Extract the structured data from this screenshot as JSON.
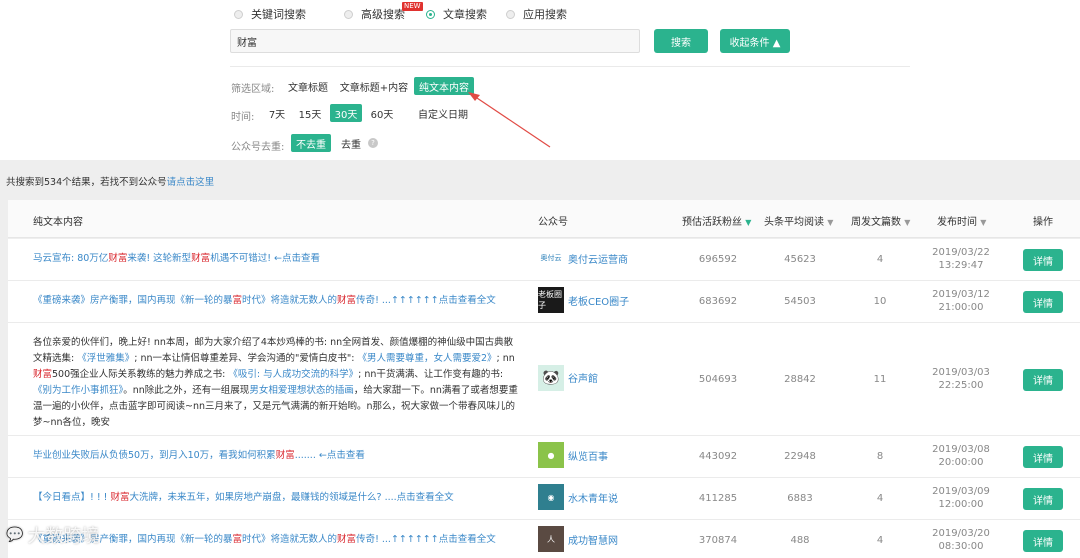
{
  "search_modes": [
    {
      "label": "关键词搜索",
      "selected": false
    },
    {
      "label": "高级搜索",
      "selected": false,
      "badge": "NEW"
    },
    {
      "label": "文章搜索",
      "selected": true
    },
    {
      "label": "应用搜索",
      "selected": false
    }
  ],
  "search": {
    "value": "财富",
    "search_button": "搜索",
    "collapse_button": "收起条件 ▲"
  },
  "filters": {
    "area_label": "筛选区域:",
    "area_options": [
      "文章标题",
      "文章标题+内容",
      "纯文本内容"
    ],
    "area_selected": 2,
    "time_label": "时间:",
    "time_options": [
      "7天",
      "15天",
      "30天",
      "60天",
      "自定义日期"
    ],
    "time_selected": 2,
    "dedupe_label": "公众号去重:",
    "dedupe_options": [
      "不去重",
      "去重"
    ],
    "dedupe_selected": 0,
    "help_icon": "help-circle-icon"
  },
  "result_summary": {
    "text": "共搜索到534个结果，若找不到公众号",
    "link": "请点击这里"
  },
  "table": {
    "headers": [
      "纯文本内容",
      "公众号",
      "预估活跃粉丝",
      "头条平均阅读",
      "周发文篇数",
      "发布时间",
      "操作"
    ],
    "detail_label": "详情",
    "rows": [
      {
        "content": [
          {
            "t": "马云宣布: 80万亿"
          },
          {
            "t": "财富",
            "red": true
          },
          {
            "t": "来袭! 这轮新型"
          },
          {
            "t": "财富",
            "red": true
          },
          {
            "t": "机遇不可错过! ←点击查看"
          }
        ],
        "account": "奥付云运营商",
        "avatar_text": "奥付云",
        "avatar_bg": "#ffffff",
        "fans": "696592",
        "reads": "45623",
        "weekly": "4",
        "date": "2019/03/22",
        "time": "13:29:47"
      },
      {
        "content": [
          {
            "t": "《重磅来袭》房产衡罪，国内再现《新一轮的暴"
          },
          {
            "t": "富",
            "red": true
          },
          {
            "t": "时代》将造就无数人的"
          },
          {
            "t": "财富",
            "red": true
          },
          {
            "t": "传奇! ...↑↑↑↑↑↑点击查看全文"
          }
        ],
        "account": "老板CEO圈子",
        "avatar_text": "老板圈子",
        "avatar_bg": "#1a1a1a",
        "fans": "683692",
        "reads": "54503",
        "weekly": "10",
        "date": "2019/03/12",
        "time": "21:00:00"
      },
      {
        "content": [
          {
            "t": "各位亲爱的伙伴们，晚上好! nn本周，邮为大家介绍了4本炒鸡棒的书: nn全网首发、颜值爆棚的神仙级中国古典散文精选集: "
          },
          {
            "t": "《浮世雅集》",
            "blue": true
          },
          {
            "t": "; nn一本让情侣尊重差异、学会沟通的\"爱情白皮书\": "
          },
          {
            "t": "《男人需要尊重，女人需要爱2》",
            "blue": true
          },
          {
            "t": "; nn"
          },
          {
            "t": "财富",
            "red": true
          },
          {
            "t": "500强企业人际关系教练的魅力养成之书: "
          },
          {
            "t": "《吸引: 与人成功交流的科学》",
            "blue": true
          },
          {
            "t": "; nn干货满满、让工作变有趣的书: "
          },
          {
            "t": "《别为工作小事抓狂》",
            "blue": true
          },
          {
            "t": "。nn除此之外，还有一组展现"
          },
          {
            "t": "男女相爱理想状态的插画",
            "blue": true
          },
          {
            "t": "，给大家甜一下。nn满看了或者想要重温一遍的小伙伴，点击蓝字即可阅读~nn三月来了，又是元气满满的新开始哟。n那么，祝大家做一个带春风味儿的梦~nn各位，晚安"
          }
        ],
        "account": "谷声館",
        "avatar_text": "🐼",
        "avatar_bg": "#d6efe6",
        "fans": "504693",
        "reads": "28842",
        "weekly": "11",
        "date": "2019/03/03",
        "time": "22:25:00"
      },
      {
        "content": [
          {
            "t": "毕业创业失败后从负债50万，到月入10万，看我如何积累"
          },
          {
            "t": "财富",
            "red": true
          },
          {
            "t": "....... ←点击查看"
          }
        ],
        "account": "纵览百事",
        "avatar_text": "●",
        "avatar_bg": "#8bc34a",
        "fans": "443092",
        "reads": "22948",
        "weekly": "8",
        "date": "2019/03/08",
        "time": "20:00:00"
      },
      {
        "content": [
          {
            "t": "【今日看点】! ! ! "
          },
          {
            "t": "财富",
            "red": true
          },
          {
            "t": "大洗牌，未来五年，如果房地产崩盘，最赚钱的领域是什么? ....点击查看全文"
          }
        ],
        "account": "水木青年说",
        "avatar_text": "◉",
        "avatar_bg": "#2f7f8f",
        "fans": "411285",
        "reads": "6883",
        "weekly": "4",
        "date": "2019/03/09",
        "time": "12:00:00"
      },
      {
        "content": [
          {
            "t": "《重磅来袭》房产衡罪，国内再现《新一轮的暴"
          },
          {
            "t": "富",
            "red": true
          },
          {
            "t": "时代》将造就无数人的"
          },
          {
            "t": "财富",
            "red": true
          },
          {
            "t": "传奇! ...↑↑↑↑↑↑点击查看全文"
          }
        ],
        "account": "成功智慧网",
        "avatar_text": "人",
        "avatar_bg": "#5a4a42",
        "fans": "370874",
        "reads": "488",
        "weekly": "4",
        "date": "2019/03/20",
        "time": "08:30:00"
      }
    ]
  },
  "watermark": "大数跨境",
  "colors": {
    "accent": "#2bb38e",
    "link": "#3a88c8",
    "highlight": "#d9272e",
    "badge": "#e0322f"
  }
}
